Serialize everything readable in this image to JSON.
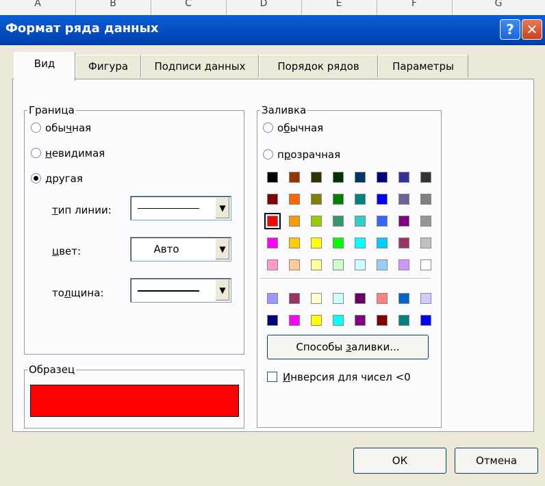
{
  "sheet_columns": [
    "A",
    "B",
    "C",
    "D",
    "E",
    "F",
    "G"
  ],
  "window": {
    "title": "Формат ряда данных",
    "help_label": "?",
    "close_label": "✕"
  },
  "tabs": [
    {
      "label": "Вид",
      "active": true
    },
    {
      "label": "Фигура"
    },
    {
      "label": "Подписи данных"
    },
    {
      "label": "Порядок рядов"
    },
    {
      "label": "Параметры"
    }
  ],
  "border": {
    "title": "Граница",
    "options": [
      {
        "pre": "обы",
        "u": "ч",
        "post": "ная",
        "selected": false
      },
      {
        "pre": "",
        "u": "н",
        "post": "евидимая",
        "selected": false
      },
      {
        "pre": "д",
        "u": "",
        "post": "ругая",
        "selected": true
      }
    ],
    "line_type_label": "тип линии:",
    "color_label": "цвет:",
    "color_value": "Авто",
    "thickness_label": "толщина:"
  },
  "sample": {
    "title": "Образец",
    "color": "#ff0000"
  },
  "fill": {
    "title": "Заливка",
    "options": [
      {
        "pre": "о",
        "u": "б",
        "post": "ычная",
        "selected": false
      },
      {
        "pre": "п",
        "u": "р",
        "post": "озрачная",
        "selected": false
      }
    ],
    "palette_main": [
      [
        "#000000",
        "#993300",
        "#333300",
        "#003300",
        "#003366",
        "#000080",
        "#333399",
        "#333333"
      ],
      [
        "#800000",
        "#ff6600",
        "#808000",
        "#008000",
        "#008080",
        "#0000ff",
        "#666699",
        "#808080"
      ],
      [
        "#ff0000",
        "#ff9900",
        "#99cc00",
        "#339966",
        "#33cccc",
        "#3366ff",
        "#800080",
        "#969696"
      ],
      [
        "#ff00ff",
        "#ffcc00",
        "#ffff00",
        "#00ff00",
        "#00ffff",
        "#00ccff",
        "#993366",
        "#c0c0c0"
      ],
      [
        "#ff99cc",
        "#ffcc99",
        "#ffff99",
        "#ccffcc",
        "#ccffff",
        "#99ccff",
        "#cc99ff",
        "#ffffff"
      ]
    ],
    "palette_extra": [
      [
        "#9999ff",
        "#993366",
        "#ffffcc",
        "#ccffff",
        "#660066",
        "#ff8080",
        "#0066cc",
        "#ccccff"
      ],
      [
        "#000080",
        "#ff00ff",
        "#ffff00",
        "#00ffff",
        "#800080",
        "#800000",
        "#008080",
        "#0000ff"
      ]
    ],
    "selected_color": "#ff0000",
    "fill_effects_button": "Способы заливки...",
    "invert_checkbox": "Инверсия для чисел <0"
  },
  "footer": {
    "ok": "ОК",
    "cancel": "Отмена"
  }
}
